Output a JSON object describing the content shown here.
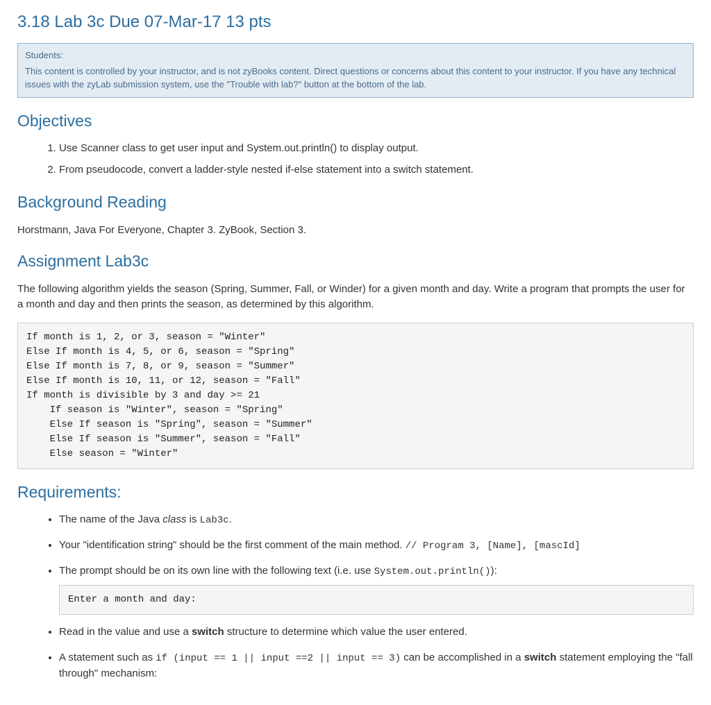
{
  "title": "3.18 Lab 3c Due 07-Mar-17 13 pts",
  "notice": {
    "heading": "Students:",
    "body": "This content is controlled by your instructor, and is not zyBooks content. Direct questions or concerns about this content to your instructor. If you have any technical issues with the zyLab submission system, use the \"Trouble with lab?\" button at the bottom of the lab."
  },
  "sections": {
    "objectives": {
      "heading": "Objectives",
      "items": [
        "Use Scanner class to get user input and System.out.println() to display output.",
        "From pseudocode, convert a ladder-style nested if-else statement into a switch statement."
      ]
    },
    "background": {
      "heading": "Background Reading",
      "body": "Horstmann, Java For Everyone, Chapter 3. ZyBook, Section 3."
    },
    "assignment": {
      "heading": "Assignment Lab3c",
      "intro": "The following algorithm yields the season (Spring, Summer, Fall, or Winder) for a given month and day. Write a program that prompts the user for a month and day and then prints the season, as determined by this algorithm.",
      "pseudocode": "If month is 1, 2, or 3, season = \"Winter\"\nElse If month is 4, 5, or 6, season = \"Spring\"\nElse If month is 7, 8, or 9, season = \"Summer\"\nElse If month is 10, 11, or 12, season = \"Fall\"\nIf month is divisible by 3 and day >= 21\n    If season is \"Winter\", season = \"Spring\"\n    Else If season is \"Spring\", season = \"Summer\"\n    Else If season is \"Summer\", season = \"Fall\"\n    Else season = \"Winter\""
    },
    "requirements": {
      "heading": "Requirements:",
      "items": {
        "r1_pre": "The name of the Java ",
        "r1_italic": "class",
        "r1_mid": " is ",
        "r1_code": "Lab3c",
        "r1_end": ".",
        "r2_pre": "Your \"identification string\" should be the first comment of the main method. ",
        "r2_code": "// Program 3, [Name], [mascId]",
        "r3_pre": "The prompt should be on its own line with the following text (i.e. use ",
        "r3_code": "System.out.println()",
        "r3_end": "):",
        "r3_block": "Enter a month and day:",
        "r4_pre": "Read in the value and use a ",
        "r4_bold": "switch",
        "r4_end": " structure to determine which value the user entered.",
        "r5_pre": "A statement such as ",
        "r5_code": "if (input == 1 || input ==2 || input == 3)",
        "r5_mid": " can be accomplished in a ",
        "r5_bold": "switch",
        "r5_end": " statement employing the \"fall through\" mechanism:"
      }
    }
  }
}
